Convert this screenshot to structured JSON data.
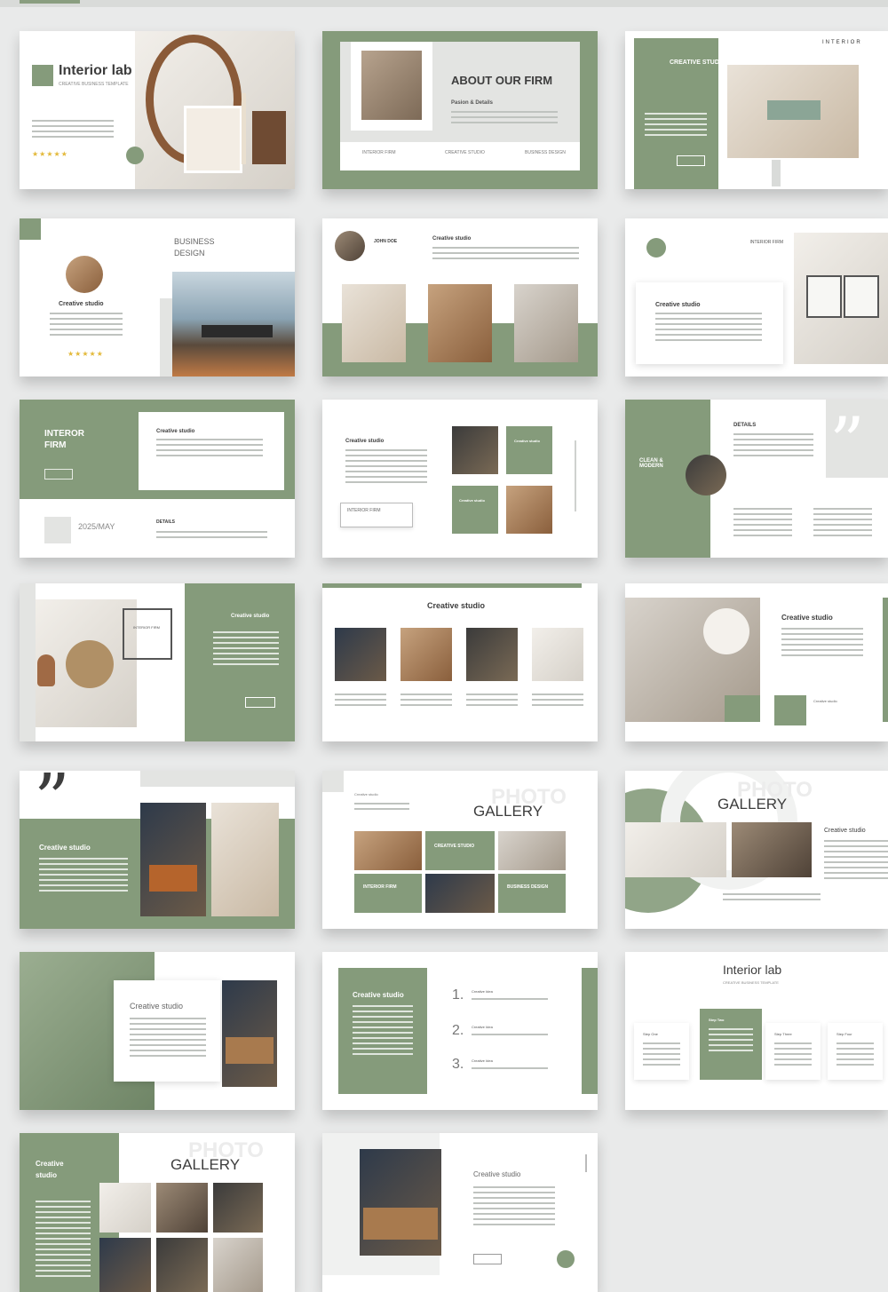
{
  "palette": {
    "green": "#859b7b",
    "light_gray": "#e9eaea",
    "dark_text": "#3d3d3d",
    "star": "#e3b93a"
  },
  "slides": {
    "s1": {
      "title": "Interior lab",
      "subtitle": "CREATIVE BUSINESS TEMPLATE",
      "stars": "★★★★★"
    },
    "s2": {
      "title": "ABOUT OUR FIRM",
      "sub": "Pasion & Details",
      "col1": "INTERIOR FIRM",
      "col2": "CREATIVE STUDIO",
      "col3": "BUSINESS DESIGN"
    },
    "s3": {
      "label": "CREATIVE STUDIO",
      "tag": "INTERIOR"
    },
    "s4": {
      "title": "BUSINESS DESIGN",
      "caption": "Creative studio",
      "stars": "★★★★★"
    },
    "s5": {
      "name": "JOHN DOE",
      "title": "Creative studio"
    },
    "s6": {
      "title": "INTERIOR FIRM",
      "card": "Creative studio"
    },
    "s7": {
      "title": "INTEROR FIRM",
      "card": "Creative studio",
      "year": "2025/MAY",
      "details": "DETAILS"
    },
    "s8": {
      "title": "Creative studio",
      "button": "INTERIOR FIRM",
      "box1": "Creative studio",
      "box2": "Creative studio"
    },
    "s9": {
      "left": "CLEAN & MODERN",
      "details": "DETAILS",
      "quote": "”"
    },
    "s10": {
      "frame": "INTERIOR FIRM",
      "title": "Creative studio"
    },
    "s11": {
      "title": "Creative studio",
      "cap": "Creative studio"
    },
    "s12": {
      "title": "Creative studio",
      "foot": "Creative studio"
    },
    "s13": {
      "quote": "”",
      "title": "Creative studio"
    },
    "s14": {
      "ghost": "PHOTO",
      "title": "GALLERY",
      "small": "Creative studio",
      "c1": "CREATIVE STUDIO",
      "c2": "INTERIOR FIRM",
      "c3": "BUSINESS DESIGN"
    },
    "s15": {
      "ghost": "PHOTO",
      "title": "GALLERY",
      "side": "Creative studio"
    },
    "s16": {
      "title": "Creative studio"
    },
    "s17": {
      "title": "Creative studio",
      "n1": "1.",
      "n2": "2.",
      "n3": "3.",
      "i1": "Creative Idea",
      "i2": "Creative Idea",
      "i3": "Creative Idea"
    },
    "s18": {
      "title": "Interior lab",
      "subtitle": "CREATIVE BUSINESS TEMPLATE",
      "col1": "Step One",
      "col2": "Step Two",
      "col3": "Step Three",
      "col4": "Step Four"
    },
    "s19": {
      "left": "Creative studio",
      "ghost": "PHOTO",
      "title": "GALLERY"
    },
    "s20": {
      "title": "Creative studio"
    }
  }
}
